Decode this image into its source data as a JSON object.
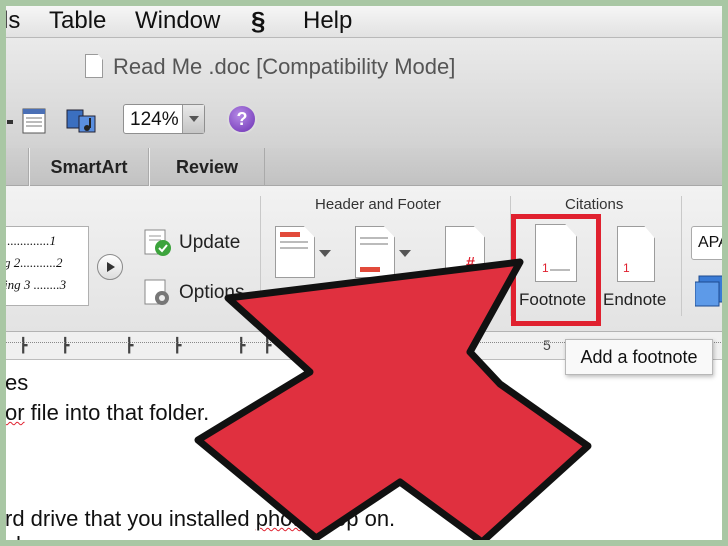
{
  "menu": {
    "items": [
      "ls",
      "Table",
      "Window",
      "Help"
    ],
    "script_icon": "script-icon"
  },
  "window": {
    "title": "Read Me .doc [Compatibility Mode]"
  },
  "toolbar": {
    "zoom_value": "124%",
    "help_glyph": "?",
    "icons": [
      "toolbox-icon",
      "media-browser-icon",
      "help-icon"
    ]
  },
  "ribbon_tabs": [
    "SmartArt",
    "Review"
  ],
  "ribbon": {
    "toc_lines": [
      "1",
      "2",
      "ing 3",
      "3"
    ],
    "toc_prefixes": [
      "",
      "g 2",
      "ing 3"
    ],
    "update_label": "Update",
    "options_label": "Options",
    "header_footer_label": "Header and Footer",
    "citations_label": "Citations",
    "footnote_label": "Footnote",
    "endnote_label": "Endnote",
    "apa_label": "APA",
    "page_number_glyph": "#",
    "footnote_glyph": "1",
    "endnote_glyph": "1"
  },
  "ruler": {
    "number": "5"
  },
  "tooltip": {
    "text": "Add a footnote"
  },
  "document": {
    "lines": [
      "es",
      "or file into that folder.",
      "rd drive that you installed photoshop on.",
      "shop"
    ],
    "line3_prefix": "rd drive that you installed ",
    "line3_squiggle": "photos",
    "line3_suffix": "hop on.",
    "line2_squiggle": "or",
    "line2_rest": " file into that folder."
  },
  "colors": {
    "highlight": "#e0212f",
    "arrow_fill": "#e0303f",
    "page_border": "#a9c7a4",
    "help_button": "#7a3cc4"
  }
}
